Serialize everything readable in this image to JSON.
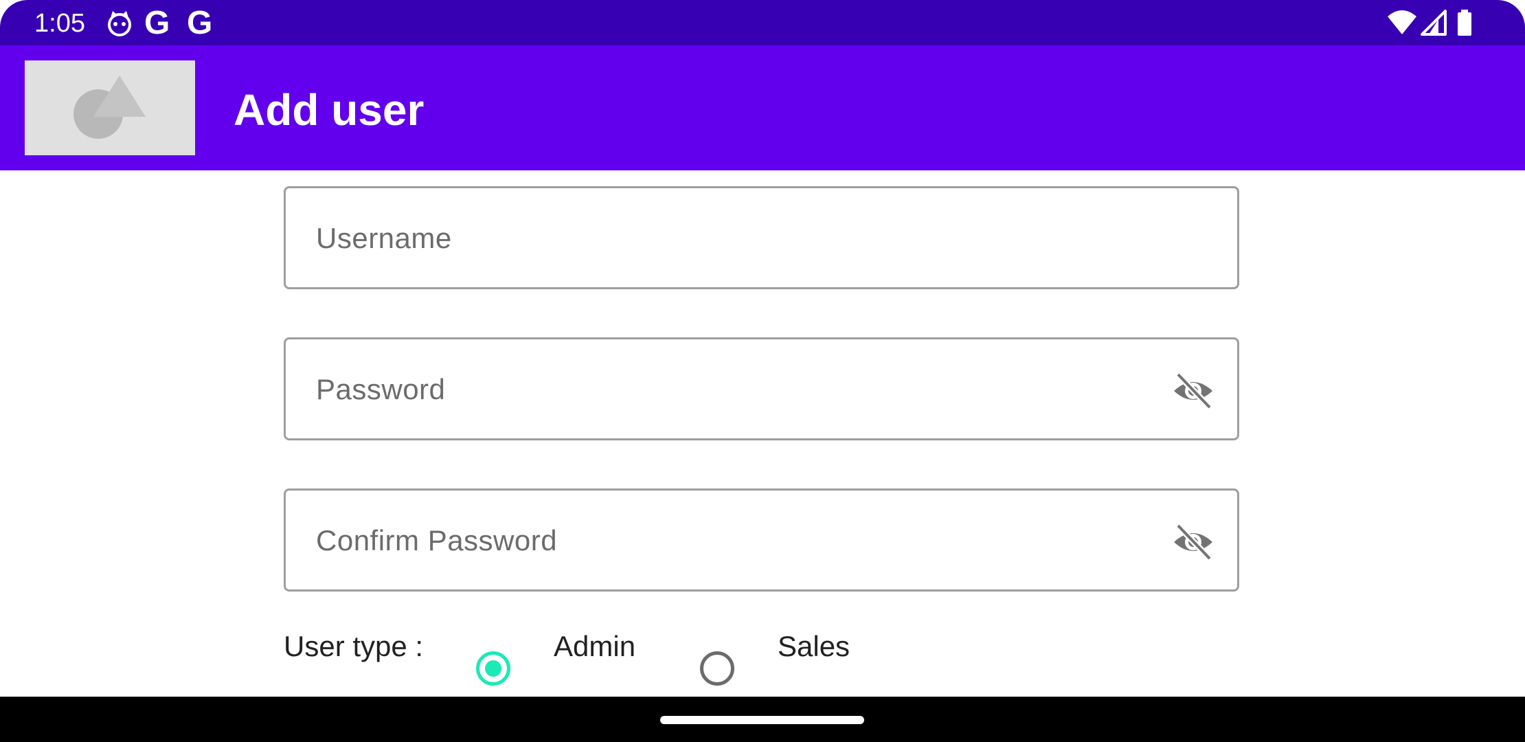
{
  "status_bar": {
    "time": "1:05",
    "notification_letters": [
      "G",
      "G"
    ],
    "icons": [
      "cat-face-icon",
      "google-icon",
      "google-icon",
      "wifi-icon",
      "cellular-signal-icon",
      "battery-icon"
    ]
  },
  "app_bar": {
    "title": "Add user",
    "logo": "placeholder-image-icon",
    "color": "#6200ee"
  },
  "form": {
    "username": {
      "placeholder": "Username",
      "value": ""
    },
    "password": {
      "placeholder": "Password",
      "value": "",
      "toggle_icon": "visibility-off-icon"
    },
    "confirm_password": {
      "placeholder": "Confirm Password",
      "value": "",
      "toggle_icon": "visibility-off-icon"
    },
    "user_type": {
      "label": "User type :",
      "options": [
        {
          "label": "Admin",
          "selected": true
        },
        {
          "label": "Sales",
          "selected": false
        }
      ],
      "accent_color": "#1de9b6"
    }
  },
  "colors": {
    "status_bar": "#3700b3",
    "app_bar": "#6200ee",
    "accent": "#1de9b6"
  }
}
